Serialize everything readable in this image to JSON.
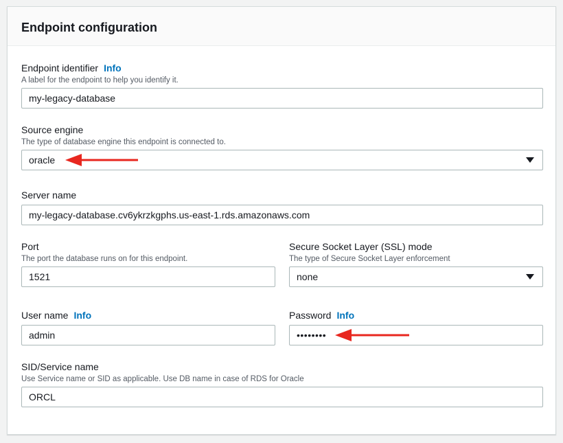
{
  "panel": {
    "title": "Endpoint configuration"
  },
  "fields": {
    "endpoint_identifier": {
      "label": "Endpoint identifier",
      "info": "Info",
      "description": "A label for the endpoint to help you identify it.",
      "value": "my-legacy-database"
    },
    "source_engine": {
      "label": "Source engine",
      "description": "The type of database engine this endpoint is connected to.",
      "value": "oracle"
    },
    "server_name": {
      "label": "Server name",
      "value": "my-legacy-database.cv6ykrzkgphs.us-east-1.rds.amazonaws.com"
    },
    "port": {
      "label": "Port",
      "description": "The port the database runs on for this endpoint.",
      "value": "1521"
    },
    "ssl_mode": {
      "label": "Secure Socket Layer (SSL) mode",
      "description": "The type of Secure Socket Layer enforcement",
      "value": "none"
    },
    "user_name": {
      "label": "User name",
      "info": "Info",
      "value": "admin"
    },
    "password": {
      "label": "Password",
      "info": "Info",
      "value": "••••••••"
    },
    "sid": {
      "label": "SID/Service name",
      "description": "Use Service name or SID as applicable. Use DB name in case of RDS for Oracle",
      "value": "ORCL"
    }
  },
  "annotations": {
    "arrow_color": "#e8271f"
  },
  "icons": {
    "dropdown": "caret-down-icon",
    "annotation": "red-arrow-icon"
  }
}
